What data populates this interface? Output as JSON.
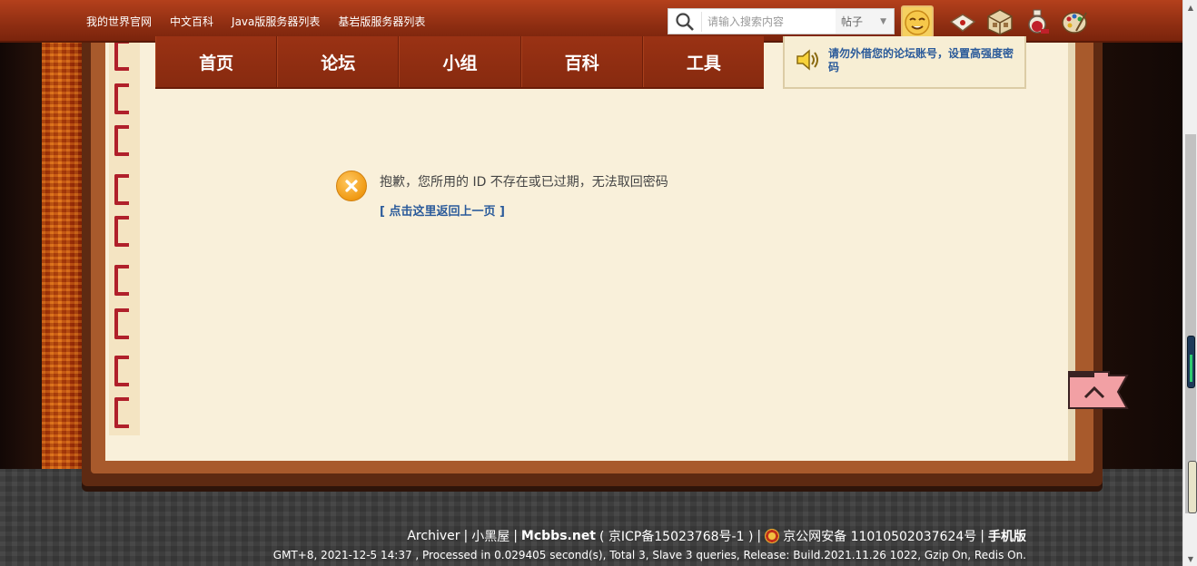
{
  "topbar": {
    "links": [
      "我的世界官网",
      "中文百科",
      "Java版服务器列表",
      "基岩版服务器列表"
    ],
    "search": {
      "placeholder": "请输入搜索内容",
      "type_label": "帖子"
    }
  },
  "nav": {
    "tabs": [
      "首页",
      "论坛",
      "小组",
      "百科",
      "工具"
    ]
  },
  "notice": {
    "text": "请勿外借您的论坛账号，设置高强度密码"
  },
  "message": {
    "text": "抱歉，您所用的 ID 不存在或已过期，无法取回密码",
    "back_link": "[ 点击这里返回上一页 ]"
  },
  "footer": {
    "archiver": "Archiver",
    "sep": "|",
    "xiaoheiwu": "小黑屋",
    "site": "Mcbbs.net",
    "icp": "( 京ICP备15023768号-1 )",
    "police": "京公网安备 11010502037624号",
    "mobile": "手机版",
    "stats": "GMT+8, 2021-12-5 14:37 , Processed in 0.029405 second(s), Total 3, Slave 3 queries, Release: Build.2021.11.26 1022, Gzip On, Redis On."
  },
  "colors": {
    "topbar": "#9a3214",
    "nav": "#8c2a10",
    "page": "#f9f0da",
    "link": "#2a5a9a",
    "warning_icon": "#f09a14"
  },
  "icons": [
    "search-icon",
    "avatar",
    "envelope-icon",
    "crafting-table-icon",
    "potion-icon",
    "palette-icon",
    "speaker-icon",
    "error-icon",
    "back-to-top-icon"
  ]
}
